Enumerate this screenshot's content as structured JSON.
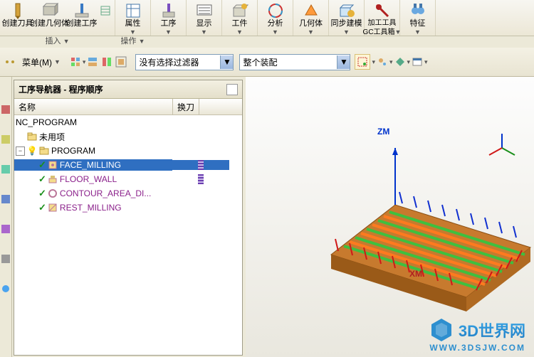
{
  "ribbon": {
    "insert_group_caption": "插入",
    "op_group_caption": "操作",
    "create_tool": "创建刀具",
    "create_geom": "创建几何体",
    "create_op": "创建工序",
    "props_btn": "属性",
    "op_btn": "工序",
    "display_btn": "显示",
    "wp_btn": "工件",
    "analyze_btn": "分析",
    "geo_btn": "几何体",
    "sync_btn": "同步建模",
    "tool1_btn": "加工工具",
    "tool2_btn": "GC工具箱",
    "feature_btn": "特征"
  },
  "tbar2": {
    "menu_label": "菜单(M)",
    "filter_combo": "没有选择过滤器",
    "assembly_combo": "整个装配"
  },
  "nav": {
    "title": "工序导航器 - 程序顺序",
    "col_name": "名称",
    "col_tool": "换刀",
    "rows": {
      "nc": "NC_PROGRAM",
      "unused": "未用项",
      "program": "PROGRAM",
      "face": "FACE_MILLING",
      "floor": "FLOOR_WALL",
      "contour": "CONTOUR_AREA_DI...",
      "rest": "REST_MILLING"
    }
  },
  "viewport": {
    "axis_z": "ZM",
    "axis_x": "XM"
  },
  "watermark": {
    "title": "3D世界网",
    "url": "WWW.3DSJW.COM"
  }
}
